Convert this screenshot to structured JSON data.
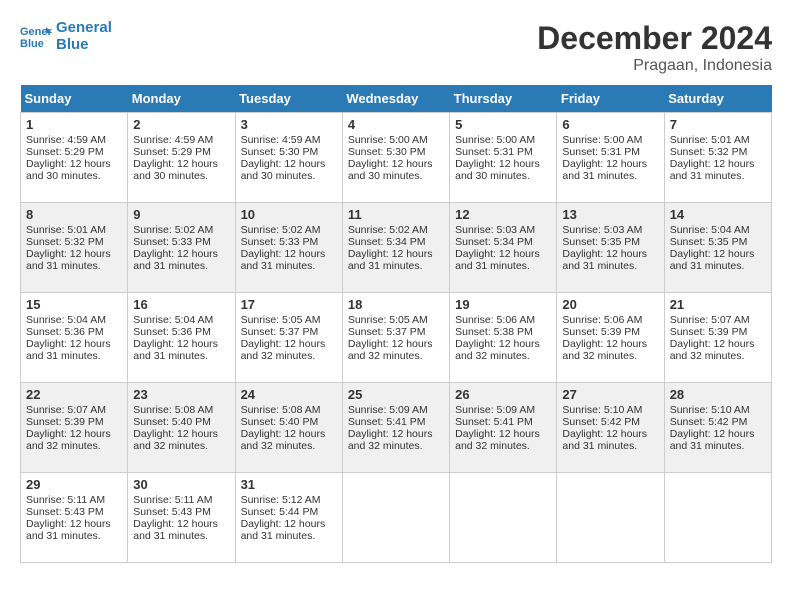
{
  "header": {
    "logo_line1": "General",
    "logo_line2": "Blue",
    "month": "December 2024",
    "location": "Pragaan, Indonesia"
  },
  "weekdays": [
    "Sunday",
    "Monday",
    "Tuesday",
    "Wednesday",
    "Thursday",
    "Friday",
    "Saturday"
  ],
  "weeks": [
    [
      {
        "day": "1",
        "lines": [
          "Sunrise: 4:59 AM",
          "Sunset: 5:29 PM",
          "Daylight: 12 hours",
          "and 30 minutes."
        ]
      },
      {
        "day": "2",
        "lines": [
          "Sunrise: 4:59 AM",
          "Sunset: 5:29 PM",
          "Daylight: 12 hours",
          "and 30 minutes."
        ]
      },
      {
        "day": "3",
        "lines": [
          "Sunrise: 4:59 AM",
          "Sunset: 5:30 PM",
          "Daylight: 12 hours",
          "and 30 minutes."
        ]
      },
      {
        "day": "4",
        "lines": [
          "Sunrise: 5:00 AM",
          "Sunset: 5:30 PM",
          "Daylight: 12 hours",
          "and 30 minutes."
        ]
      },
      {
        "day": "5",
        "lines": [
          "Sunrise: 5:00 AM",
          "Sunset: 5:31 PM",
          "Daylight: 12 hours",
          "and 30 minutes."
        ]
      },
      {
        "day": "6",
        "lines": [
          "Sunrise: 5:00 AM",
          "Sunset: 5:31 PM",
          "Daylight: 12 hours",
          "and 31 minutes."
        ]
      },
      {
        "day": "7",
        "lines": [
          "Sunrise: 5:01 AM",
          "Sunset: 5:32 PM",
          "Daylight: 12 hours",
          "and 31 minutes."
        ]
      }
    ],
    [
      {
        "day": "8",
        "lines": [
          "Sunrise: 5:01 AM",
          "Sunset: 5:32 PM",
          "Daylight: 12 hours",
          "and 31 minutes."
        ]
      },
      {
        "day": "9",
        "lines": [
          "Sunrise: 5:02 AM",
          "Sunset: 5:33 PM",
          "Daylight: 12 hours",
          "and 31 minutes."
        ]
      },
      {
        "day": "10",
        "lines": [
          "Sunrise: 5:02 AM",
          "Sunset: 5:33 PM",
          "Daylight: 12 hours",
          "and 31 minutes."
        ]
      },
      {
        "day": "11",
        "lines": [
          "Sunrise: 5:02 AM",
          "Sunset: 5:34 PM",
          "Daylight: 12 hours",
          "and 31 minutes."
        ]
      },
      {
        "day": "12",
        "lines": [
          "Sunrise: 5:03 AM",
          "Sunset: 5:34 PM",
          "Daylight: 12 hours",
          "and 31 minutes."
        ]
      },
      {
        "day": "13",
        "lines": [
          "Sunrise: 5:03 AM",
          "Sunset: 5:35 PM",
          "Daylight: 12 hours",
          "and 31 minutes."
        ]
      },
      {
        "day": "14",
        "lines": [
          "Sunrise: 5:04 AM",
          "Sunset: 5:35 PM",
          "Daylight: 12 hours",
          "and 31 minutes."
        ]
      }
    ],
    [
      {
        "day": "15",
        "lines": [
          "Sunrise: 5:04 AM",
          "Sunset: 5:36 PM",
          "Daylight: 12 hours",
          "and 31 minutes."
        ]
      },
      {
        "day": "16",
        "lines": [
          "Sunrise: 5:04 AM",
          "Sunset: 5:36 PM",
          "Daylight: 12 hours",
          "and 31 minutes."
        ]
      },
      {
        "day": "17",
        "lines": [
          "Sunrise: 5:05 AM",
          "Sunset: 5:37 PM",
          "Daylight: 12 hours",
          "and 32 minutes."
        ]
      },
      {
        "day": "18",
        "lines": [
          "Sunrise: 5:05 AM",
          "Sunset: 5:37 PM",
          "Daylight: 12 hours",
          "and 32 minutes."
        ]
      },
      {
        "day": "19",
        "lines": [
          "Sunrise: 5:06 AM",
          "Sunset: 5:38 PM",
          "Daylight: 12 hours",
          "and 32 minutes."
        ]
      },
      {
        "day": "20",
        "lines": [
          "Sunrise: 5:06 AM",
          "Sunset: 5:39 PM",
          "Daylight: 12 hours",
          "and 32 minutes."
        ]
      },
      {
        "day": "21",
        "lines": [
          "Sunrise: 5:07 AM",
          "Sunset: 5:39 PM",
          "Daylight: 12 hours",
          "and 32 minutes."
        ]
      }
    ],
    [
      {
        "day": "22",
        "lines": [
          "Sunrise: 5:07 AM",
          "Sunset: 5:39 PM",
          "Daylight: 12 hours",
          "and 32 minutes."
        ]
      },
      {
        "day": "23",
        "lines": [
          "Sunrise: 5:08 AM",
          "Sunset: 5:40 PM",
          "Daylight: 12 hours",
          "and 32 minutes."
        ]
      },
      {
        "day": "24",
        "lines": [
          "Sunrise: 5:08 AM",
          "Sunset: 5:40 PM",
          "Daylight: 12 hours",
          "and 32 minutes."
        ]
      },
      {
        "day": "25",
        "lines": [
          "Sunrise: 5:09 AM",
          "Sunset: 5:41 PM",
          "Daylight: 12 hours",
          "and 32 minutes."
        ]
      },
      {
        "day": "26",
        "lines": [
          "Sunrise: 5:09 AM",
          "Sunset: 5:41 PM",
          "Daylight: 12 hours",
          "and 32 minutes."
        ]
      },
      {
        "day": "27",
        "lines": [
          "Sunrise: 5:10 AM",
          "Sunset: 5:42 PM",
          "Daylight: 12 hours",
          "and 31 minutes."
        ]
      },
      {
        "day": "28",
        "lines": [
          "Sunrise: 5:10 AM",
          "Sunset: 5:42 PM",
          "Daylight: 12 hours",
          "and 31 minutes."
        ]
      }
    ],
    [
      {
        "day": "29",
        "lines": [
          "Sunrise: 5:11 AM",
          "Sunset: 5:43 PM",
          "Daylight: 12 hours",
          "and 31 minutes."
        ]
      },
      {
        "day": "30",
        "lines": [
          "Sunrise: 5:11 AM",
          "Sunset: 5:43 PM",
          "Daylight: 12 hours",
          "and 31 minutes."
        ]
      },
      {
        "day": "31",
        "lines": [
          "Sunrise: 5:12 AM",
          "Sunset: 5:44 PM",
          "Daylight: 12 hours",
          "and 31 minutes."
        ]
      },
      null,
      null,
      null,
      null
    ]
  ]
}
